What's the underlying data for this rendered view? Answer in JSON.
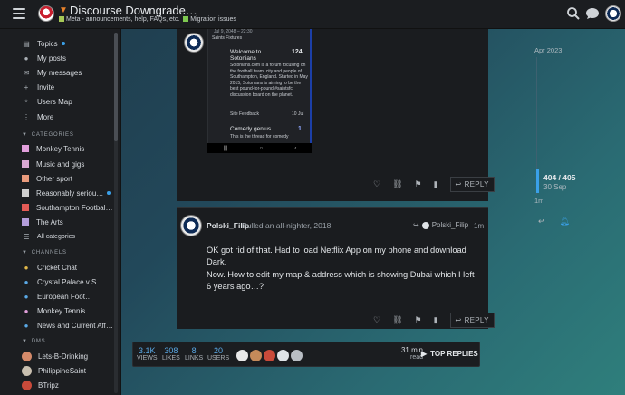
{
  "header": {
    "title": "Discourse Downgrade…",
    "categories": [
      {
        "label": "Meta - announcements, help, FAQs, etc.",
        "color": "#a7c957"
      },
      {
        "label": "Migration issues",
        "color": "#7ec850"
      }
    ],
    "icons": [
      "menu-icon",
      "search-icon",
      "chat-icon",
      "grid-icon",
      "avatar"
    ]
  },
  "sidebar": {
    "top_items": [
      {
        "label": "Topics",
        "icon": "topics-icon",
        "dot": true
      },
      {
        "label": "My posts",
        "icon": "person-icon"
      },
      {
        "label": "My messages",
        "icon": "envelope-icon"
      },
      {
        "label": "Invite",
        "icon": "invite-icon"
      },
      {
        "label": "Users Map",
        "icon": "map-icon"
      },
      {
        "label": "More",
        "icon": "ellipsis-icon"
      }
    ],
    "categories_heading": "CATEGORIES",
    "categories": [
      {
        "label": "Monkey Tennis",
        "color": "#e19fdb"
      },
      {
        "label": "Music and gigs",
        "color": "#d9a8d3"
      },
      {
        "label": "Other sport",
        "color": "#e99b7c"
      },
      {
        "label": "Reasonably seriou…",
        "color": "#cfcfcf",
        "dot": true
      },
      {
        "label": "Southampton Footbal…",
        "color": "#e35b56"
      },
      {
        "label": "The Arts",
        "color": "#b39ddb"
      },
      {
        "label": "All categories",
        "color": ""
      }
    ],
    "channels_heading": "CHANNELS",
    "channels": [
      {
        "label": "Crystal Palace v S…",
        "icon": "chat-icon"
      },
      {
        "label": "European Foot…",
        "icon": "chat-icon"
      },
      {
        "label": "Monkey Tennis",
        "icon": "chat-icon"
      },
      {
        "label": "News and Current Aff…",
        "icon": "chat-icon"
      }
    ],
    "cricket_channel": "Cricket Chat",
    "dms_heading": "DMS",
    "dms": [
      {
        "label": "Lets-B-Drinking",
        "color": "#d48a6a"
      },
      {
        "label": "PhilippineSaint",
        "color": "#c9c0b0"
      },
      {
        "label": "BTripz",
        "color": "#c94a3a"
      }
    ]
  },
  "post1": {
    "screenshot": {
      "date_line": "Jul 9, 2048 – 22:30",
      "subcategory": "Saints Fixtures",
      "welcome_title": "Welcome to Sotonians",
      "welcome_count": "124",
      "welcome_body": "Sotonians.com is a forum focusing on the football team, city and people of Southampton, England. Started in May 2015, Sotonians is aiming to be the best pound-for-pound #saintsfc discussion board on the planet.",
      "welcome_tag": "Site Feedback",
      "welcome_date": "10 Jul",
      "comedy_title": "Comedy genius",
      "comedy_count": "1",
      "comedy_body": "This is the thread for comedy"
    },
    "reply_label": "REPLY"
  },
  "post2": {
    "username": "Polski_Filip",
    "user_title": "Pulled an all-nighter, 2018",
    "reply_to": "Polski_Filip",
    "time": "1m",
    "paragraphs": [
      "OK got rid of that. Had to load Netflix App on my phone and download Dark.",
      "Now. How to edit my map & address which is showing Dubai which I left 6 years ago…?"
    ],
    "reply_label": "REPLY"
  },
  "stats": {
    "views": "3.1K",
    "views_label": "VIEWS",
    "replies": "308",
    "replies_label": "LIKES",
    "links": "8",
    "links_label": "LINKS",
    "users": "20",
    "users_label": "USERS",
    "read_time": "31 min",
    "read_label": "read",
    "top_replies": "TOP REPLIES"
  },
  "timeline": {
    "start": "Apr 2023",
    "position": "404 / 405",
    "date": "30 Sep",
    "end": "1m"
  }
}
